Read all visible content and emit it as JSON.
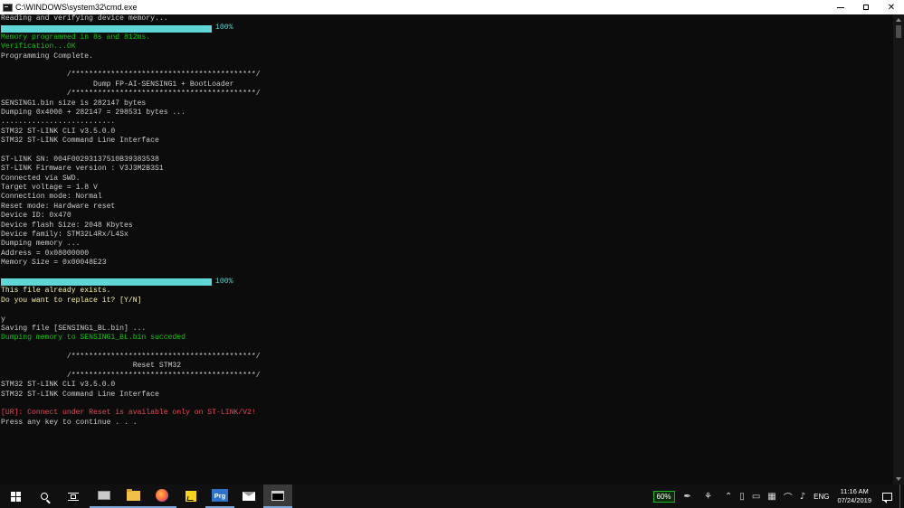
{
  "window": {
    "title": "C:\\WINDOWS\\system32\\cmd.exe"
  },
  "console": {
    "lines": [
      {
        "type": "text",
        "text": "Reading and verifying device memory...",
        "color": "white"
      },
      {
        "type": "progress",
        "percent": 100,
        "label": "100%"
      },
      {
        "type": "text",
        "text": "Memory programmed in 8s and 812ms.",
        "color": "green"
      },
      {
        "type": "text",
        "text": "Verification...OK",
        "color": "green"
      },
      {
        "type": "text",
        "text": "Programming Complete.",
        "color": "white"
      },
      {
        "type": "text",
        "text": "",
        "color": "white"
      },
      {
        "type": "text",
        "text": "               /******************************************/",
        "color": "white"
      },
      {
        "type": "text",
        "text": "                     Dump FP-AI-SENSING1 + BootLoader",
        "color": "white"
      },
      {
        "type": "text",
        "text": "               /******************************************/",
        "color": "white"
      },
      {
        "type": "text",
        "text": "SENSING1.bin size is 282147 bytes",
        "color": "white"
      },
      {
        "type": "text",
        "text": "Dumping 0x4000 + 282147 = 298531 bytes ...",
        "color": "white"
      },
      {
        "type": "text",
        "text": "..........................",
        "color": "white"
      },
      {
        "type": "text",
        "text": "STM32 ST-LINK CLI v3.5.0.0",
        "color": "white"
      },
      {
        "type": "text",
        "text": "STM32 ST-LINK Command Line Interface",
        "color": "white"
      },
      {
        "type": "text",
        "text": "",
        "color": "white"
      },
      {
        "type": "text",
        "text": "ST-LINK SN: 004F00293137510B39383538",
        "color": "white"
      },
      {
        "type": "text",
        "text": "ST-LINK Firmware version : V3J3M2B3S1",
        "color": "white"
      },
      {
        "type": "text",
        "text": "Connected via SWD.",
        "color": "white"
      },
      {
        "type": "text",
        "text": "Target voltage = 1.8 V",
        "color": "white"
      },
      {
        "type": "text",
        "text": "Connection mode: Normal",
        "color": "white"
      },
      {
        "type": "text",
        "text": "Reset mode: Hardware reset",
        "color": "white"
      },
      {
        "type": "text",
        "text": "Device ID: 0x470",
        "color": "white"
      },
      {
        "type": "text",
        "text": "Device flash Size: 2048 Kbytes",
        "color": "white"
      },
      {
        "type": "text",
        "text": "Device family: STM32L4Rx/L4Sx",
        "color": "white"
      },
      {
        "type": "text",
        "text": "Dumping memory ...",
        "color": "white"
      },
      {
        "type": "text",
        "text": "Address = 0x08000000",
        "color": "white"
      },
      {
        "type": "text",
        "text": "Memory Size = 0x00048E23",
        "color": "white"
      },
      {
        "type": "text",
        "text": "",
        "color": "white"
      },
      {
        "type": "progress",
        "percent": 100,
        "label": "100%"
      },
      {
        "type": "text",
        "text": "This file already exists.",
        "color": "yellow"
      },
      {
        "type": "text",
        "text": "Do you want to replace it? [Y/N]",
        "color": "yellow"
      },
      {
        "type": "text",
        "text": "",
        "color": "white"
      },
      {
        "type": "text",
        "text": "y",
        "color": "white"
      },
      {
        "type": "text",
        "text": "Saving file [SENSING1_BL.bin] ...",
        "color": "white"
      },
      {
        "type": "text",
        "text": "Dumping memory to SENSING1_BL.bin succeded",
        "color": "green"
      },
      {
        "type": "text",
        "text": "",
        "color": "white"
      },
      {
        "type": "text",
        "text": "               /******************************************/",
        "color": "white"
      },
      {
        "type": "text",
        "text": "                              Reset STM32",
        "color": "white"
      },
      {
        "type": "text",
        "text": "               /******************************************/",
        "color": "white"
      },
      {
        "type": "text",
        "text": "STM32 ST-LINK CLI v3.5.0.0",
        "color": "white"
      },
      {
        "type": "text",
        "text": "STM32 ST-LINK Command Line Interface",
        "color": "white"
      },
      {
        "type": "text",
        "text": "",
        "color": "white"
      },
      {
        "type": "text",
        "text": "[UR]: Connect under Reset is available only on ST-LINK/V2!",
        "color": "red"
      },
      {
        "type": "text",
        "text": "Press any key to continue . . .",
        "color": "white"
      }
    ]
  },
  "taskbar": {
    "apps": [
      {
        "name": "file-explorer-pc",
        "icon": "computer-icon"
      },
      {
        "name": "file-explorer-folder",
        "icon": "folder-icon"
      },
      {
        "name": "firefox",
        "icon": "firefox-icon"
      },
      {
        "name": "sticky-notes",
        "icon": "sticky-notes-icon"
      },
      {
        "name": "prg",
        "icon": "prg-icon",
        "label": "Prg"
      },
      {
        "name": "mail",
        "icon": "mail-icon"
      },
      {
        "name": "command-prompt",
        "icon": "cmd-icon"
      }
    ],
    "tray": {
      "battery_percent": "60%",
      "language": "ENG",
      "time": "11:16 AM",
      "date": "07/24/2019"
    }
  },
  "colors": {
    "background": "#0c0c0c",
    "text": "#cccccc",
    "green": "#16c60c",
    "yellow": "#f9f1a5",
    "red": "#e74856",
    "progress": "#61d6d6"
  }
}
